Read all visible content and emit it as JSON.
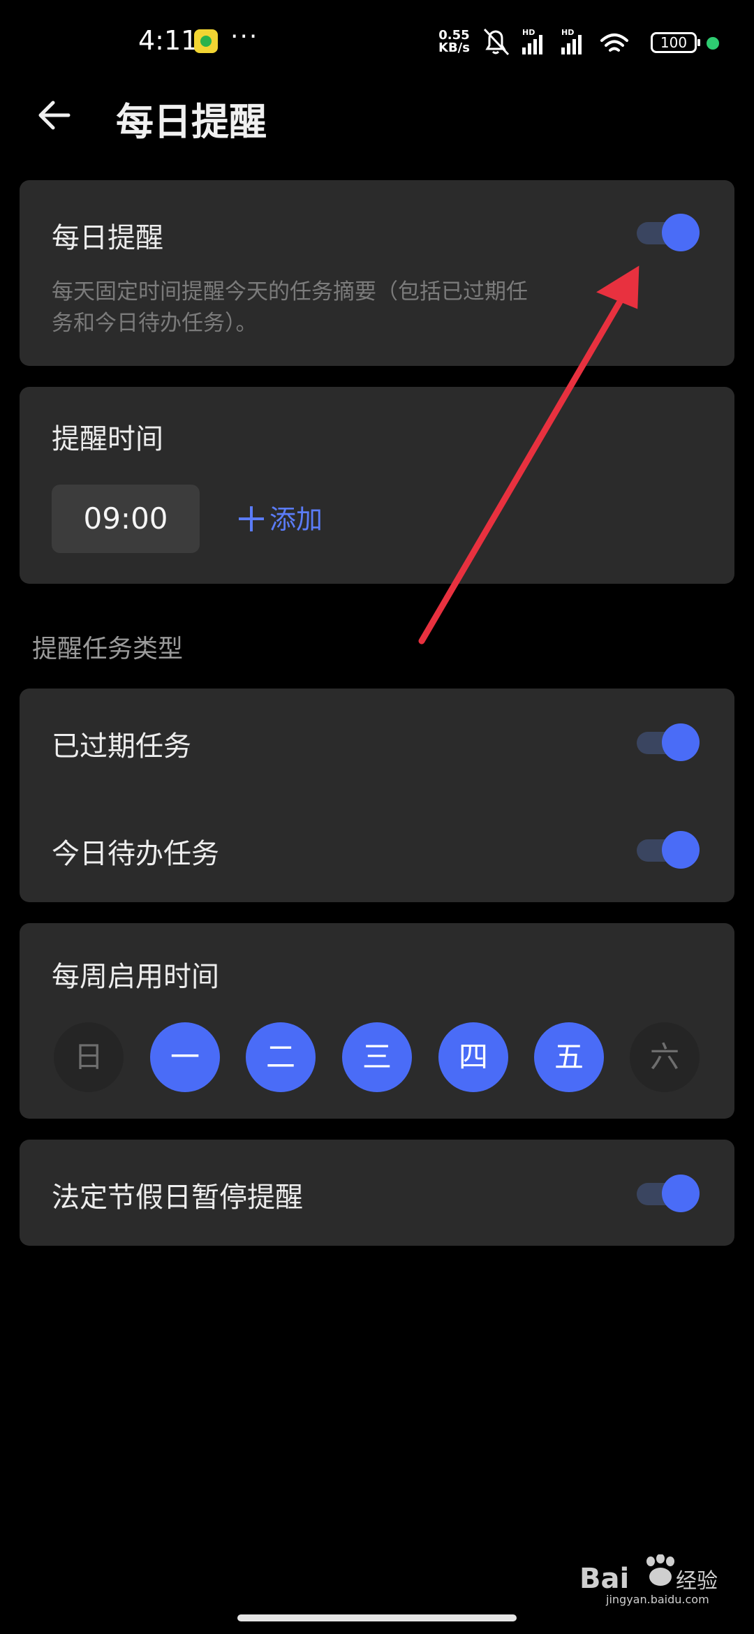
{
  "status_bar": {
    "time": "4:11",
    "dots": "···",
    "net_speed_value": "0.55",
    "net_speed_unit": "KB/s",
    "hd1": "HD",
    "hd2": "HD",
    "battery": "100"
  },
  "header": {
    "title": "每日提醒"
  },
  "daily_reminder": {
    "title": "每日提醒",
    "description": "每天固定时间提醒今天的任务摘要（包括已过期任务和今日待办任务）。",
    "enabled": true
  },
  "reminder_time": {
    "title": "提醒时间",
    "time": "09:00",
    "add_label": "添加"
  },
  "task_types": {
    "section_label": "提醒任务类型",
    "items": [
      {
        "label": "已过期任务",
        "enabled": true
      },
      {
        "label": "今日待办任务",
        "enabled": true
      }
    ]
  },
  "weekly": {
    "title": "每周启用时间",
    "days": [
      {
        "label": "日",
        "active": false
      },
      {
        "label": "一",
        "active": true
      },
      {
        "label": "二",
        "active": true
      },
      {
        "label": "三",
        "active": true
      },
      {
        "label": "四",
        "active": true
      },
      {
        "label": "五",
        "active": true
      },
      {
        "label": "六",
        "active": false
      }
    ]
  },
  "holiday": {
    "label": "法定节假日暂停提醒",
    "enabled": true
  },
  "watermark": {
    "brand": "Bai",
    "suffix": "经验",
    "url": "jingyan.baidu.com"
  },
  "colors": {
    "accent": "#4a6cf7",
    "annotation_arrow": "#e8313f"
  }
}
